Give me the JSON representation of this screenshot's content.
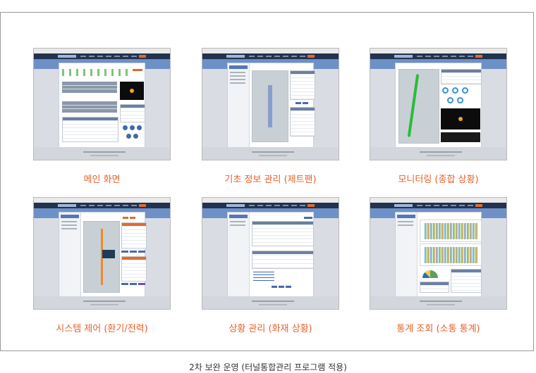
{
  "cards": [
    {
      "caption": "메인 화면",
      "screen": "main"
    },
    {
      "caption": "기초 정보 관리 (제트팬)",
      "screen": "basic-info"
    },
    {
      "caption": "모니터링 (종합 상황)",
      "screen": "monitoring"
    },
    {
      "caption": "시스템 제어 (환기/전력)",
      "screen": "system-control"
    },
    {
      "caption": "상황 관리 (화재 상황)",
      "screen": "incident"
    },
    {
      "caption": "통계 조회 (소통 통계)",
      "screen": "statistics"
    }
  ],
  "bottom_caption": "2차 보완 운영 (터널통합관리 프로그램 적용)",
  "colors": {
    "caption": "#e8612b",
    "app_bar": "#22324f",
    "sub_bar": "#6d90c6",
    "footer": "#d3d7dd"
  }
}
